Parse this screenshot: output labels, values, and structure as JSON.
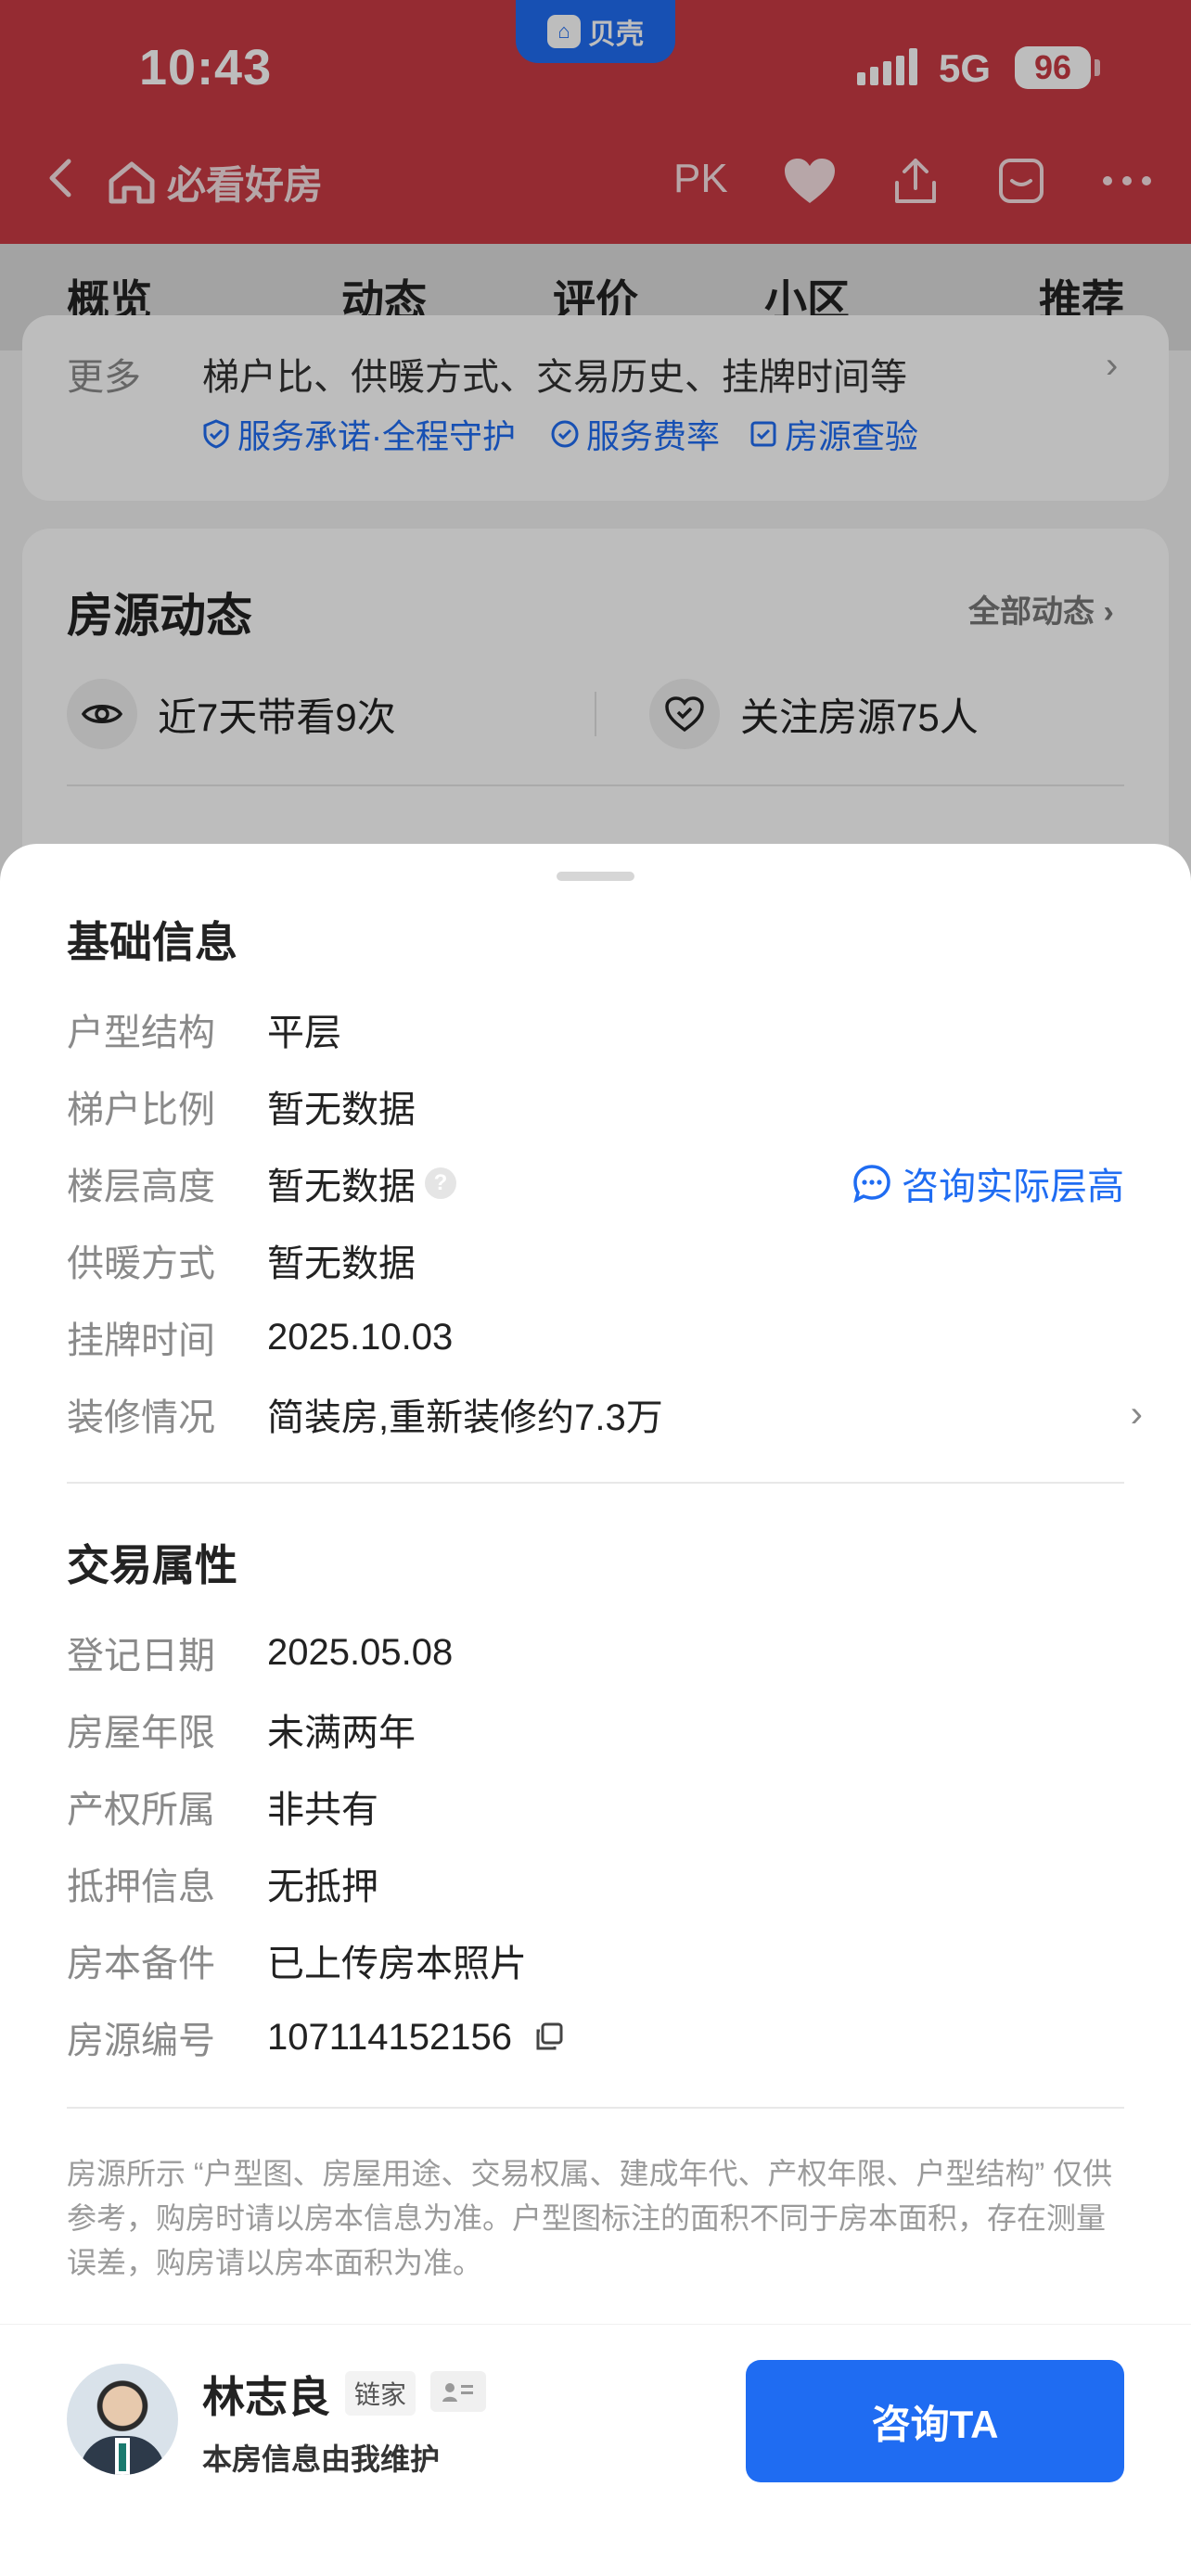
{
  "status_bar": {
    "time": "10:43",
    "network": "5G",
    "battery": "96",
    "app_badge": "贝壳"
  },
  "navbar": {
    "brand": "必看好房",
    "pk_label": "PK"
  },
  "tabs": [
    "概览",
    "动态",
    "评价",
    "小区",
    "推荐"
  ],
  "overview_card": {
    "more_label": "更多",
    "more_text": "梯户比、供暖方式、交易历史、挂牌时间等",
    "services": [
      "服务承诺·全程守护",
      "服务费率",
      "房源查验"
    ]
  },
  "dynamics_card": {
    "title": "房源动态",
    "all_link": "全部动态",
    "views_text": "近7天带看9次",
    "follow_text": "关注房源75人"
  },
  "sheet": {
    "basic_title": "基础信息",
    "basic_rows": [
      {
        "label": "户型结构",
        "value": "平层"
      },
      {
        "label": "梯户比例",
        "value": "暂无数据"
      },
      {
        "label": "楼层高度",
        "value": "暂无数据"
      },
      {
        "label": "供暖方式",
        "value": "暂无数据"
      },
      {
        "label": "挂牌时间",
        "value": "2025.10.03"
      },
      {
        "label": "装修情况",
        "value": "简装房,重新装修约7.3万"
      }
    ],
    "consult_floor_link": "咨询实际层高",
    "trade_title": "交易属性",
    "trade_rows": [
      {
        "label": "登记日期",
        "value": "2025.05.08"
      },
      {
        "label": "房屋年限",
        "value": "未满两年"
      },
      {
        "label": "产权所属",
        "value": "非共有"
      },
      {
        "label": "抵押信息",
        "value": "无抵押"
      },
      {
        "label": "房本备件",
        "value": "已上传房本照片"
      },
      {
        "label": "房源编号",
        "value": "107114152156"
      }
    ],
    "disclaimer": "房源所示 “户型图、房屋用途、交易权属、建成年代、产权年限、户型结构” 仅供参考，购房时请以房本信息为准。户型图标注的面积不同于房本面积，存在测量误差，购房请以房本面积为准。"
  },
  "agent": {
    "name": "林志良",
    "brand": "链家",
    "note": "本房信息由我维护",
    "consult_button": "咨询TA"
  },
  "colors": {
    "header_red": "#c93a44",
    "accent_blue": "#1f6cf2"
  }
}
